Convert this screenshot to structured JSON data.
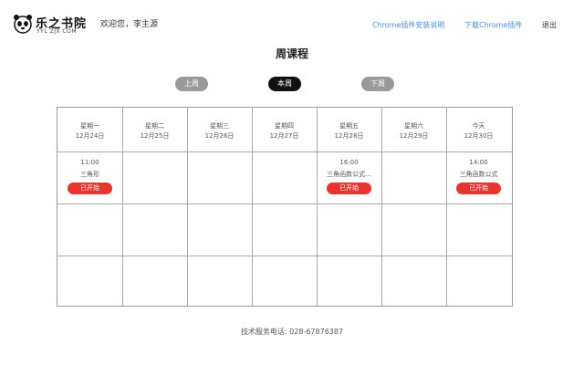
{
  "header": {
    "brand": "乐之书院",
    "domain": "YYL ZJX COM",
    "welcome": "欢迎您，李主源",
    "nav": [
      {
        "label": "Chrome插件安装说明"
      },
      {
        "label": "下载Chrome插件"
      }
    ],
    "logout": "退出"
  },
  "page_title": "周课程",
  "week_nav": {
    "prev": "上周",
    "current": "本周",
    "next": "下周"
  },
  "days": [
    {
      "weekday": "星期一",
      "date": "12月24日"
    },
    {
      "weekday": "星期二",
      "date": "12月25日"
    },
    {
      "weekday": "星期三",
      "date": "12月26日"
    },
    {
      "weekday": "星期四",
      "date": "12月27日"
    },
    {
      "weekday": "星期五",
      "date": "12月28日"
    },
    {
      "weekday": "星期六",
      "date": "12月29日"
    },
    {
      "weekday": "今天",
      "date": "12月30日"
    }
  ],
  "courses": [
    {
      "time": "11:00",
      "name": "三角形",
      "status": "已开始"
    },
    {
      "time": "16:00",
      "name": "三角函数公式...",
      "status": "已开始"
    },
    {
      "time": "14:00",
      "name": "三角函数公式",
      "status": "已开始"
    }
  ],
  "footer": {
    "text": "技术服务电话: 028-67876387"
  },
  "colors": {
    "accent_red": "#e8342c",
    "link_blue": "#4a90d9",
    "dark_btn": "#111111",
    "gray_btn": "#999999"
  }
}
